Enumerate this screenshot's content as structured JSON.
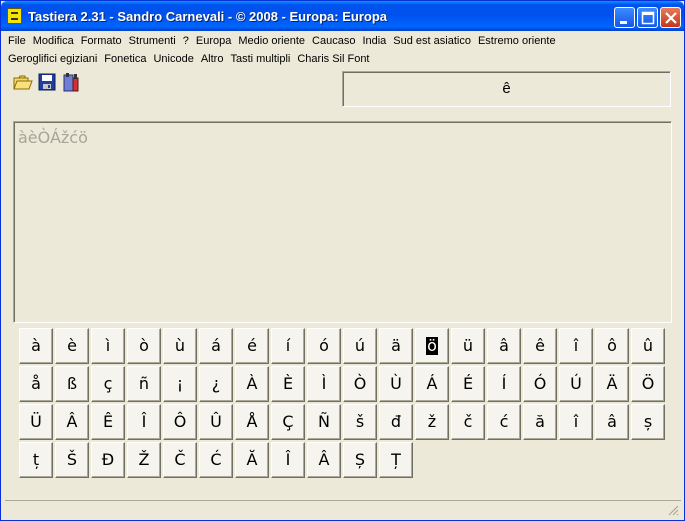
{
  "window": {
    "title": "Tastiera 2.31 - Sandro Carnevali - ©  2008 - Europa: Europa"
  },
  "menu": {
    "row1": [
      "File",
      "Modifica",
      "Formato",
      "Strumenti",
      "?",
      "Europa",
      "Medio oriente",
      "Caucaso",
      "India",
      "Sud est asiatico",
      "Estremo oriente"
    ],
    "row2": [
      "Geroglifici egiziani",
      "Fonetica",
      "Unicode",
      "Altro",
      "Tasti multipli",
      "Charis Sil Font"
    ]
  },
  "toolbar": {
    "icons": [
      "open-folder-icon",
      "save-icon",
      "info-icon"
    ]
  },
  "preview": {
    "char": "ê"
  },
  "editor": {
    "text": "àèÒÁžćö"
  },
  "keyboard": {
    "selected_index": 11,
    "rows": [
      [
        "à",
        "è",
        "ì",
        "ò",
        "ù",
        "á",
        "é",
        "í",
        "ó",
        "ú",
        "ä",
        "ö",
        "ü",
        "â",
        "ê",
        "î",
        "ô",
        "û"
      ],
      [
        "å",
        "ß",
        "ç",
        "ñ",
        "¡",
        "¿",
        "À",
        "È",
        "Ì",
        "Ò",
        "Ù",
        "Á",
        "É",
        "Í",
        "Ó",
        "Ú",
        "Ä",
        "Ö"
      ],
      [
        "Ü",
        "Â",
        "Ê",
        "Î",
        "Ô",
        "Û",
        "Å",
        "Ç",
        "Ñ",
        "š",
        "đ",
        "ž",
        "č",
        "ć",
        "ă",
        "î",
        "â",
        "ș"
      ],
      [
        "ț",
        "Š",
        "Đ",
        "Ž",
        "Č",
        "Ć",
        "Ă",
        "Î",
        "Â",
        "Ș",
        "Ț"
      ]
    ]
  },
  "colors": {
    "titlebar": "#0053EE",
    "face": "#ECE9D8",
    "editor_text": "#A7A59A"
  }
}
